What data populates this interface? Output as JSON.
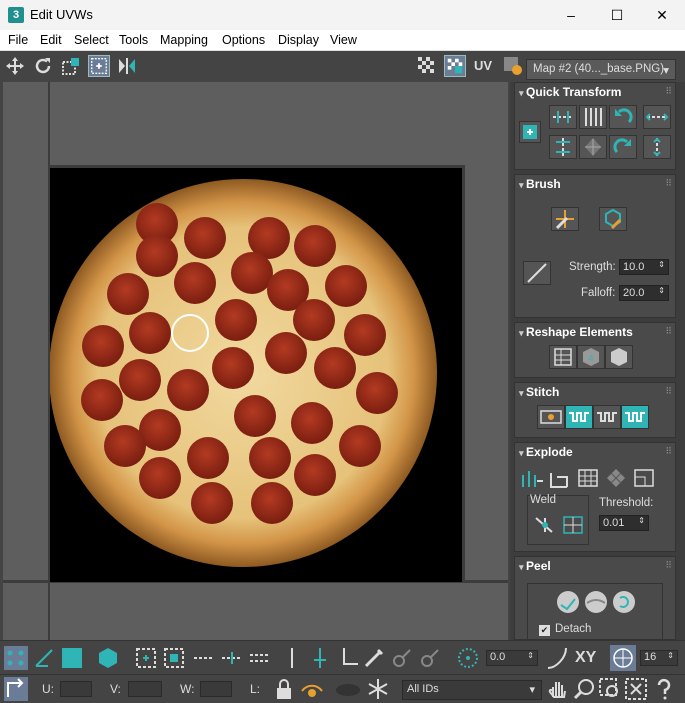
{
  "window": {
    "title": "Edit UVWs",
    "minimize": "–",
    "maximize": "☐",
    "close": "✕",
    "app_icon": "3"
  },
  "menu": [
    "File",
    "Edit",
    "Select",
    "Tools",
    "Mapping",
    "Options",
    "Display",
    "View"
  ],
  "toolbar": {
    "uv_label": "UV",
    "map_select": "Map #2 (40..._base.PNG)"
  },
  "rollouts": {
    "quick_transform": "Quick Transform",
    "brush": {
      "title": "Brush",
      "strength_label": "Strength:",
      "strength_value": "10.0",
      "falloff_label": "Falloff:",
      "falloff_value": "20.0"
    },
    "reshape": "Reshape Elements",
    "stitch": "Stitch",
    "explode": {
      "title": "Explode",
      "weld_label": "Weld",
      "threshold_label": "Threshold:",
      "threshold_value": "0.01"
    },
    "peel": {
      "title": "Peel",
      "detach_label": "Detach"
    }
  },
  "bottom": {
    "angle_value": "0.0",
    "xy_label": "XY",
    "grid_value": "16",
    "u_label": "U:",
    "v_label": "V:",
    "w_label": "W:",
    "l_label": "L:",
    "ids_select": "All IDs"
  },
  "colors": {
    "accent": "#2fb5b5",
    "panel": "#4a4a4a",
    "pizza_crust": "#c88a3c",
    "pepperoni": "#9a2a18"
  }
}
